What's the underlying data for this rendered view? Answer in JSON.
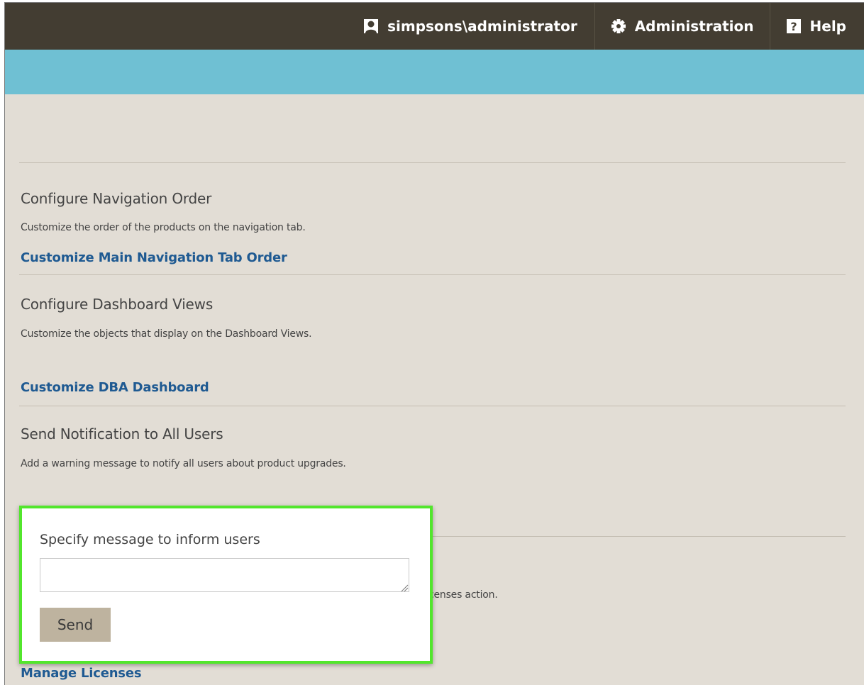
{
  "header": {
    "user": "simpsons\\administrator",
    "administration": "Administration",
    "help": "Help",
    "icons": {
      "user": "user-icon",
      "gear": "gear-icon",
      "help": "help-icon"
    }
  },
  "sections": {
    "nav_order": {
      "title": "Configure Navigation Order",
      "description": "Customize the order of the products on the navigation tab.",
      "link": "Customize Main Navigation Tab Order"
    },
    "dashboard": {
      "title": "Configure Dashboard Views",
      "description": "Customize the objects that display on the Dashboard Views.",
      "link": "Customize DBA Dashboard"
    },
    "notification": {
      "title": "Send Notification to All Users",
      "description": "Add a warning message to notify all users about product upgrades."
    },
    "licenses": {
      "description_fragment": "censes action.",
      "link": "Manage Licenses"
    }
  },
  "popup": {
    "label": "Specify message to inform users",
    "textarea_value": "",
    "send_label": "Send"
  },
  "colors": {
    "topbar": "#433d32",
    "strip": "#6fc0d3",
    "background": "#e2ddd5",
    "link": "#1f5a92",
    "highlight": "#52e62c",
    "send_button": "#beb39f"
  }
}
